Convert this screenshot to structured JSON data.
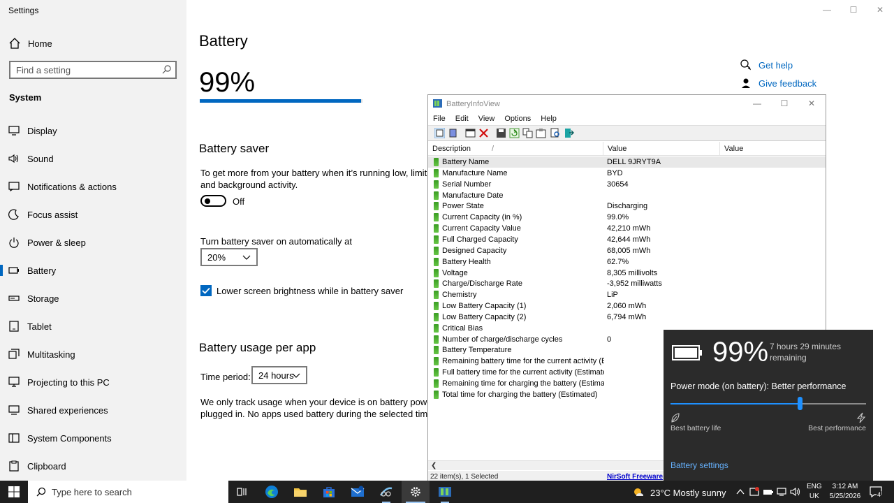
{
  "settings": {
    "title": "Settings",
    "window_controls": {
      "minimize": "—",
      "maximize": "☐",
      "close": "✕"
    },
    "home_label": "Home",
    "search_placeholder": "Find a setting",
    "section": "System",
    "nav": [
      {
        "label": "Display",
        "icon": "display-icon"
      },
      {
        "label": "Sound",
        "icon": "sound-icon"
      },
      {
        "label": "Notifications & actions",
        "icon": "notifications-icon"
      },
      {
        "label": "Focus assist",
        "icon": "focus-assist-icon"
      },
      {
        "label": "Power & sleep",
        "icon": "power-icon"
      },
      {
        "label": "Battery",
        "icon": "battery-icon",
        "active": true
      },
      {
        "label": "Storage",
        "icon": "storage-icon"
      },
      {
        "label": "Tablet",
        "icon": "tablet-icon"
      },
      {
        "label": "Multitasking",
        "icon": "multitasking-icon"
      },
      {
        "label": "Projecting to this PC",
        "icon": "projecting-icon"
      },
      {
        "label": "Shared experiences",
        "icon": "shared-experiences-icon"
      },
      {
        "label": "System Components",
        "icon": "system-components-icon"
      },
      {
        "label": "Clipboard",
        "icon": "clipboard-icon"
      }
    ],
    "page_title": "Battery",
    "battery_percent": "99%",
    "battery_level": 0.99,
    "battery_saver_heading": "Battery saver",
    "battery_saver_desc": "To get more from your battery when it’s running low, limit notifi",
    "battery_saver_desc_2": "and background activity.",
    "toggle_state": "Off",
    "auto_on_label": "Turn battery saver on automatically at",
    "auto_on_value": "20%",
    "lower_brightness_label": "Lower screen brightness while in battery saver",
    "usage_heading": "Battery usage per app",
    "time_period_label": "Time period:",
    "time_period_value": "24 hours",
    "usage_note_1": "We only track usage when your device is on battery power, not",
    "usage_note_2": "plugged in. No apps used battery during the selected time perio",
    "get_help": "Get help",
    "give_feedback": "Give feedback"
  },
  "biv": {
    "title": "BatteryInfoView",
    "menu": [
      "File",
      "Edit",
      "View",
      "Options",
      "Help"
    ],
    "columns": [
      "Description",
      "Value",
      "Value"
    ],
    "sort_indicator": "/",
    "rows": [
      {
        "desc": "Battery Name",
        "value": "DELL 9JRYT9A"
      },
      {
        "desc": "Manufacture Name",
        "value": "BYD"
      },
      {
        "desc": "Serial Number",
        "value": "30654"
      },
      {
        "desc": "Manufacture Date",
        "value": ""
      },
      {
        "desc": "Power State",
        "value": "Discharging"
      },
      {
        "desc": "Current Capacity (in %)",
        "value": "99.0%"
      },
      {
        "desc": "Current Capacity Value",
        "value": "42,210 mWh"
      },
      {
        "desc": "Full Charged Capacity",
        "value": "42,644 mWh"
      },
      {
        "desc": "Designed Capacity",
        "value": "68,005 mWh"
      },
      {
        "desc": "Battery Health",
        "value": "62.7%"
      },
      {
        "desc": "Voltage",
        "value": "8,305 millivolts"
      },
      {
        "desc": "Charge/Discharge Rate",
        "value": "-3,952 milliwatts"
      },
      {
        "desc": "Chemistry",
        "value": "LiP"
      },
      {
        "desc": "Low Battery Capacity (1)",
        "value": "2,060 mWh"
      },
      {
        "desc": "Low Battery Capacity (2)",
        "value": "6,794 mWh"
      },
      {
        "desc": "Critical Bias",
        "value": ""
      },
      {
        "desc": "Number of charge/discharge cycles",
        "value": "0"
      },
      {
        "desc": "Battery Temperature",
        "value": ""
      },
      {
        "desc": "Remaining battery time for the current activity (Est...",
        "value": ""
      },
      {
        "desc": "Full battery time for the current activity (Estimated)",
        "value": ""
      },
      {
        "desc": "Remaining time for charging the battery (Estimated)",
        "value": ""
      },
      {
        "desc": "Total  time for charging the battery (Estimated)",
        "value": ""
      }
    ],
    "status_items": "22 item(s), 1 Selected",
    "status_link": "NirSoft Freeware"
  },
  "flyout": {
    "percent": "99%",
    "remaining": "7 hours 29 minutes remaining",
    "power_mode": "Power mode (on battery): Better performance",
    "slider_level": 0.66,
    "left_label": "Best battery life",
    "right_label": "Best performance",
    "settings_link": "Battery settings"
  },
  "taskbar": {
    "search_placeholder": "Type here to search",
    "weather": "23°C  Mostly sunny",
    "lang_1": "ENG",
    "lang_2": "UK",
    "time": "3:12 AM",
    "date": "5/25/2026",
    "notification_count": "4"
  },
  "colors": {
    "accent": "#0067c0",
    "flyout_bg": "#2b2b2b",
    "taskbar_bg": "#1f1f1f"
  }
}
